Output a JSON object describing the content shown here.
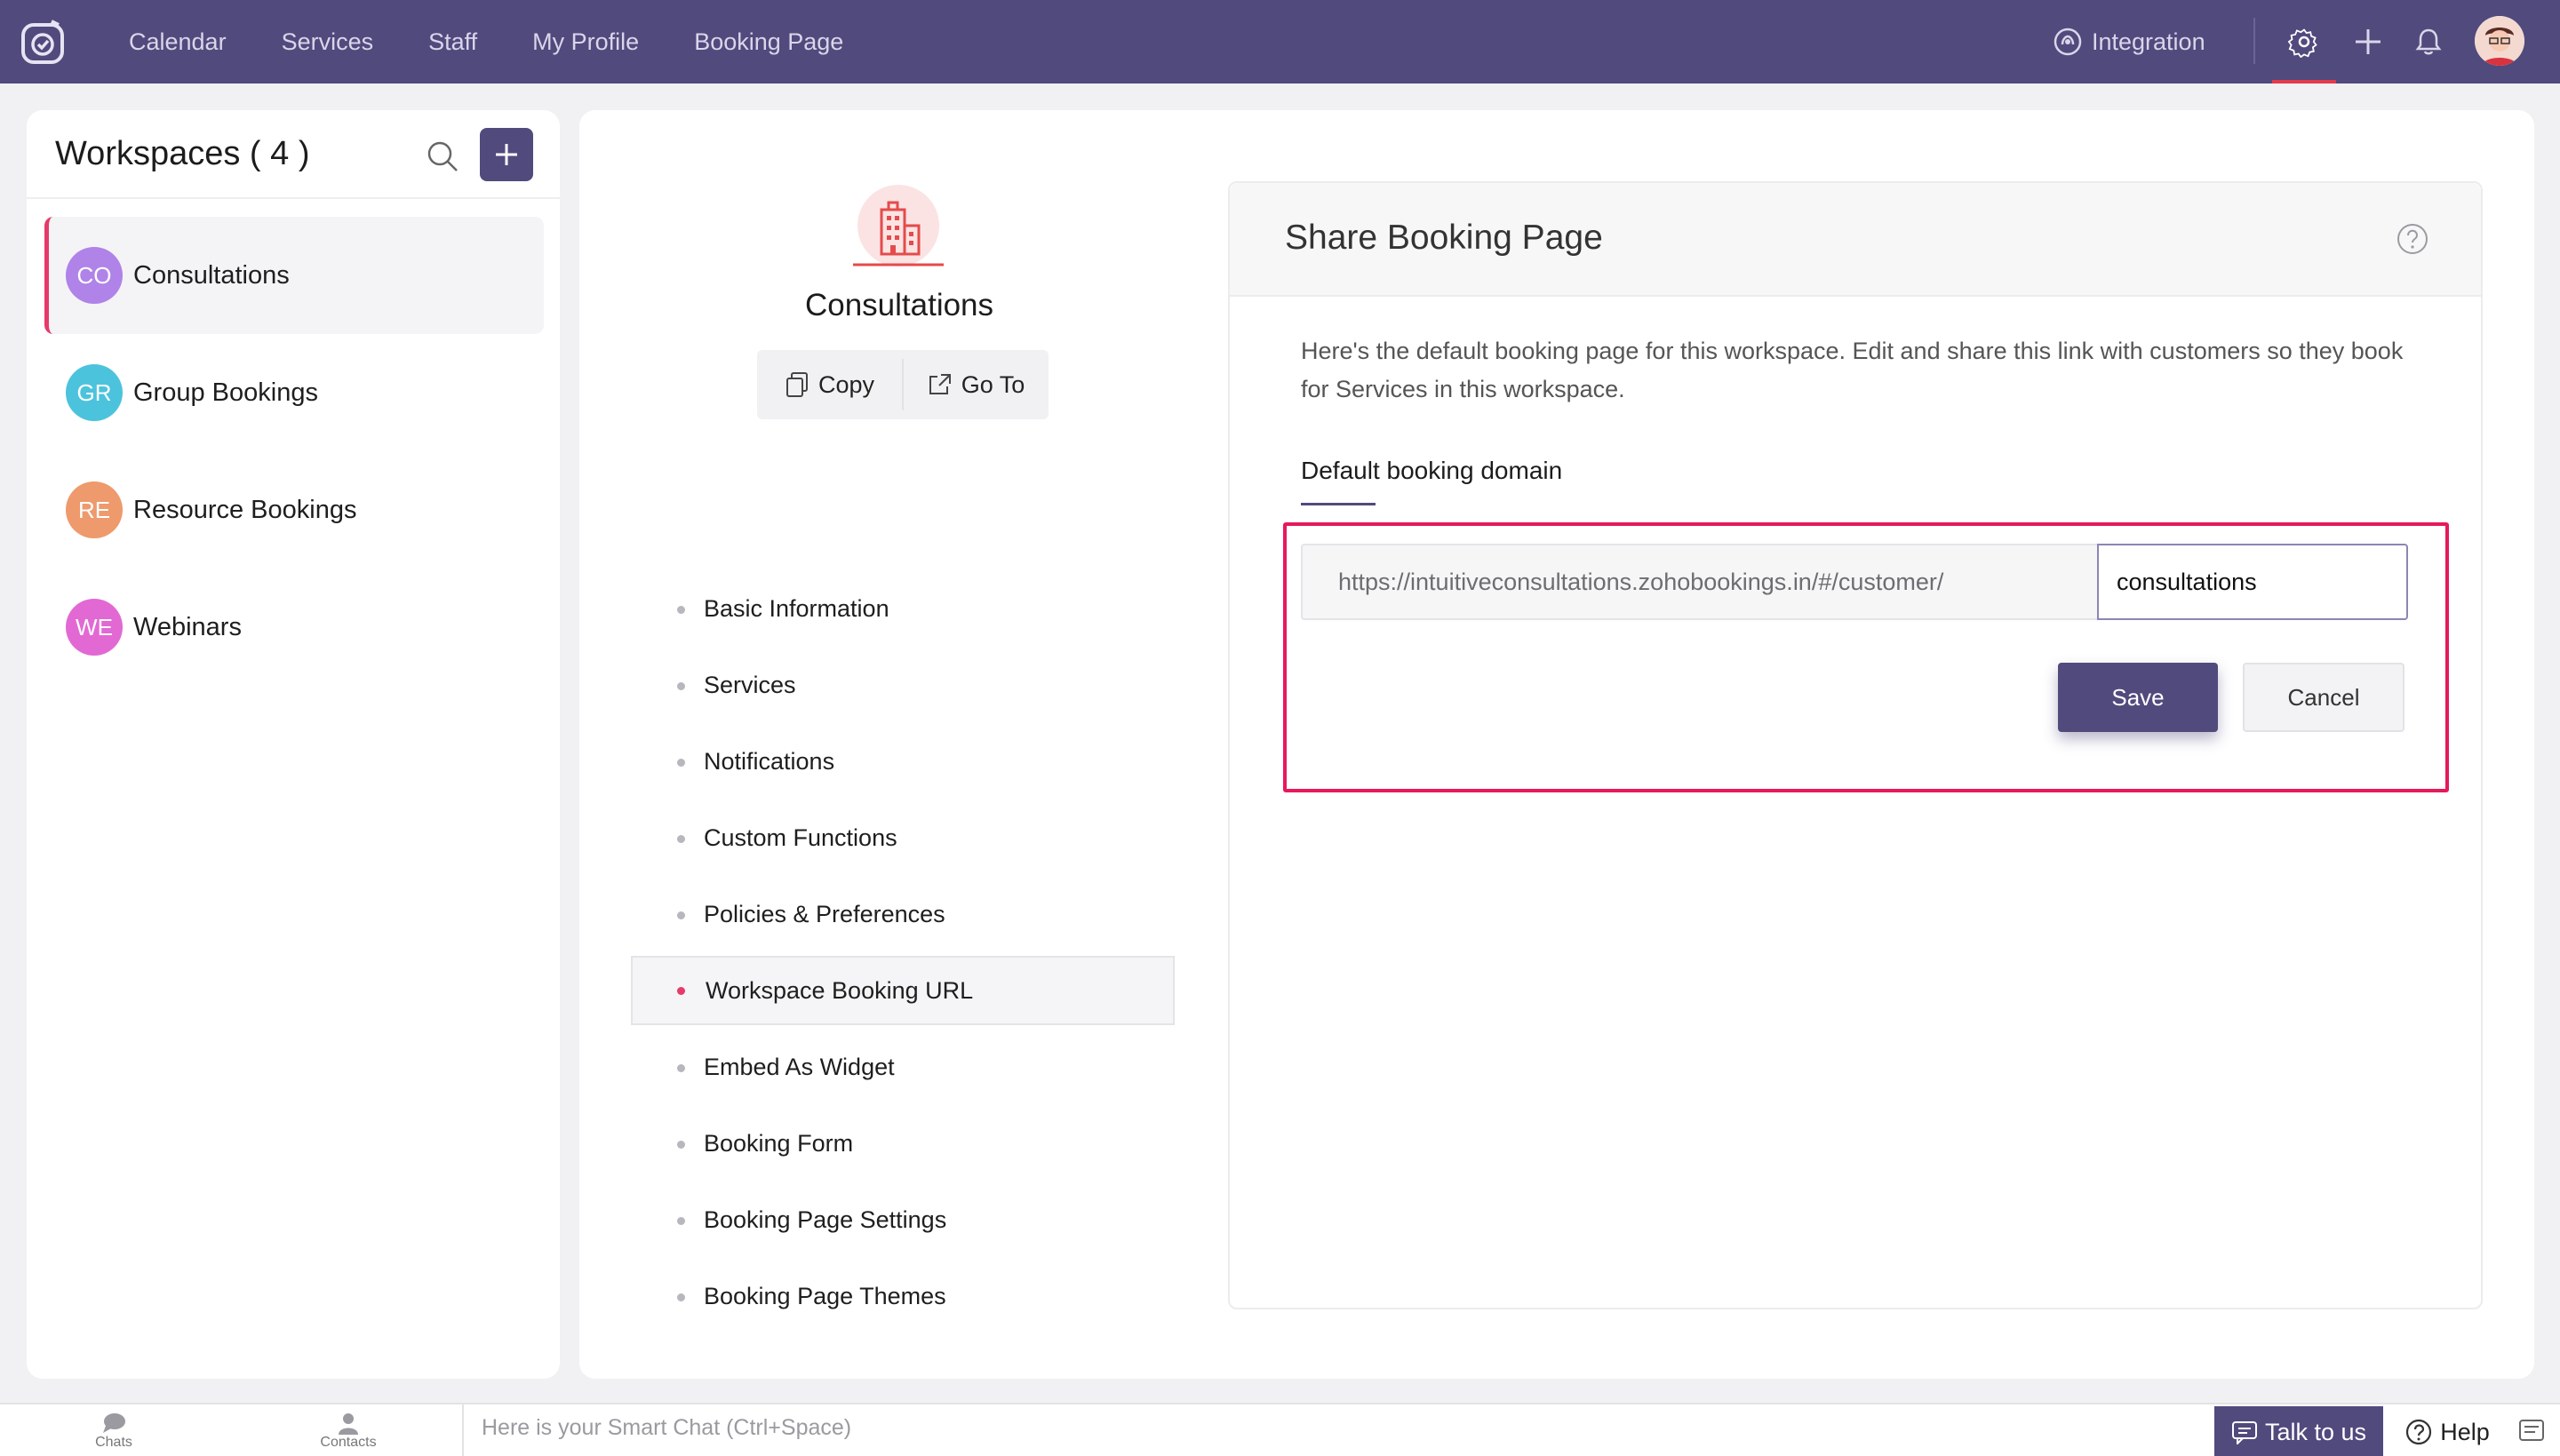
{
  "nav": {
    "items": [
      "Calendar",
      "Services",
      "Staff",
      "My Profile",
      "Booking Page"
    ],
    "integration": "Integration"
  },
  "sidebar": {
    "title": "Workspaces ( 4 )",
    "items": [
      {
        "initials": "CO",
        "label": "Consultations",
        "color": "#b083e8",
        "active": true
      },
      {
        "initials": "GR",
        "label": "Group Bookings",
        "color": "#4cc3dc",
        "active": false
      },
      {
        "initials": "RE",
        "label": "Resource Bookings",
        "color": "#ee9a6c",
        "active": false
      },
      {
        "initials": "WE",
        "label": "Webinars",
        "color": "#e269d3",
        "active": false
      }
    ]
  },
  "workspace": {
    "name": "Consultations",
    "copy_label": "Copy",
    "goto_label": "Go To",
    "menu": [
      "Basic Information",
      "Services",
      "Notifications",
      "Custom Functions",
      "Policies & Preferences",
      "Workspace Booking URL",
      "Embed As Widget",
      "Booking Form",
      "Booking Page Settings",
      "Booking Page Themes"
    ],
    "active_menu_index": 5
  },
  "share": {
    "title": "Share Booking Page",
    "description": "Here's the default booking page for this workspace. Edit and share this link with customers so they book for Services in this workspace.",
    "domain_label": "Default booking domain",
    "url_prefix": "https://intuitiveconsultations.zohobookings.in/#/customer/",
    "url_slug": "consultations",
    "save_label": "Save",
    "cancel_label": "Cancel"
  },
  "bottom": {
    "chats": "Chats",
    "contacts": "Contacts",
    "smart_chat_placeholder": "Here is your Smart Chat (Ctrl+Space)",
    "talk_label": "Talk to us",
    "help_label": "Help"
  },
  "colors": {
    "brand": "#514a7d",
    "accent": "#e53a6a",
    "highlight": "#e5195b"
  }
}
